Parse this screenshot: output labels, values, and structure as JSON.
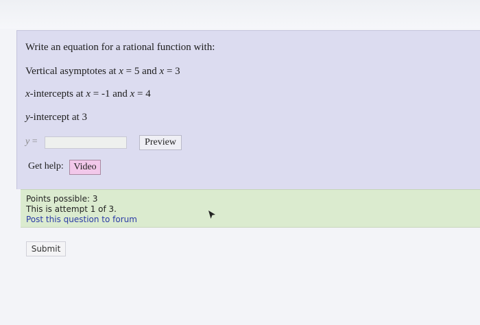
{
  "question": {
    "prompt": "Write an equation for a rational function with:",
    "vertical_asymptotes": {
      "label": "Vertical asymptotes at ",
      "var1": "x",
      "eq1": " = 5 and ",
      "var2": "x",
      "eq2": " = 3"
    },
    "x_intercepts": {
      "var_label": "x",
      "label": "-intercepts at ",
      "var1": "x",
      "eq1": " = -1 and ",
      "var2": "x",
      "eq2": " = 4"
    },
    "y_intercept": {
      "var_label": "y",
      "label": "-intercept at 3"
    },
    "answer": {
      "var": "y",
      "equals": " =",
      "value": ""
    },
    "preview_label": "Preview",
    "get_help_label": "Get help:",
    "video_label": "Video"
  },
  "info": {
    "points": "Points possible: 3",
    "attempt": "This is attempt 1 of 3.",
    "forum_link": "Post this question to forum"
  },
  "submit_label": "Submit",
  "colors": {
    "question_bg": "#dcdcf0",
    "info_bg": "#dbebcf",
    "video_button_bg": "#f2c8ea",
    "link": "#2a3aa6"
  }
}
